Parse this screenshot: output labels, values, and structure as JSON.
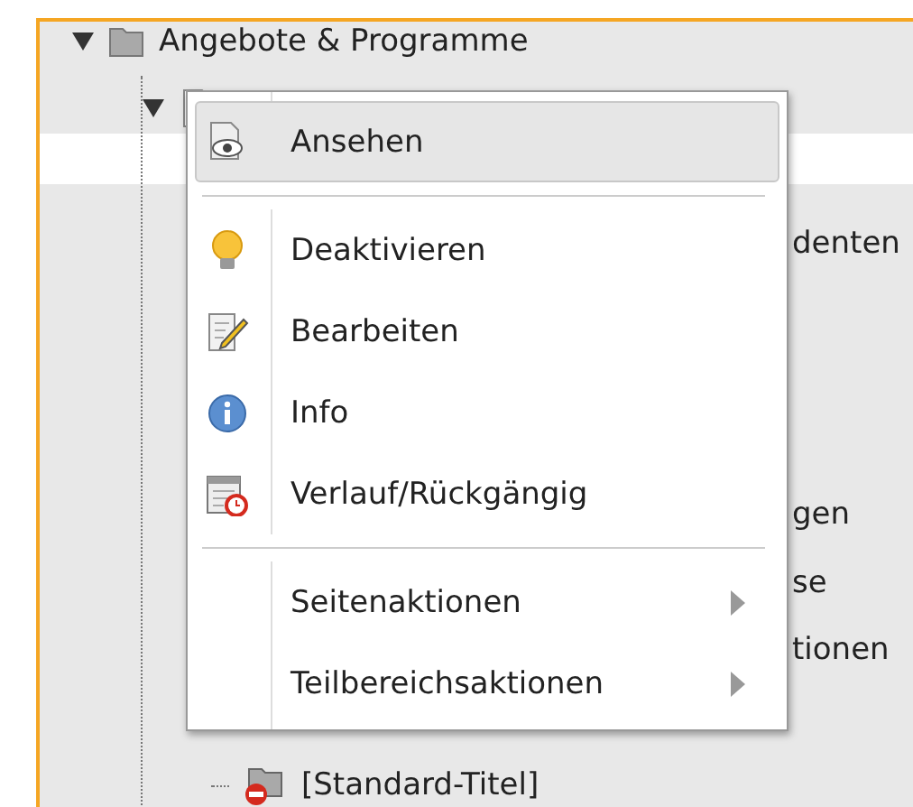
{
  "tree": [
    {
      "kind": "folder",
      "label": "Angebote & Programme",
      "expanded": true,
      "children": [
        {
          "kind": "page",
          "expanded": true,
          "children": [
            {
              "kind": "fragment",
              "label": "denten"
            },
            {
              "kind": "fragment",
              "label": "gen"
            },
            {
              "kind": "fragment",
              "label": "se"
            },
            {
              "kind": "fragment",
              "label": "tionen"
            },
            {
              "kind": "folder-hidden",
              "label": "[Standard-Titel]"
            }
          ]
        }
      ]
    }
  ],
  "context_menu": {
    "groups": [
      [
        {
          "label": "Ansehen",
          "kind": "view",
          "selected": true,
          "submenu": false
        }
      ],
      [
        {
          "label": "Deaktivieren",
          "kind": "bulb",
          "selected": false,
          "submenu": false
        },
        {
          "label": "Bearbeiten",
          "kind": "edit",
          "selected": false,
          "submenu": false
        },
        {
          "label": "Info",
          "kind": "info",
          "selected": false,
          "submenu": false
        },
        {
          "label": "Verlauf/Rückgängig",
          "kind": "history",
          "selected": false,
          "submenu": false
        }
      ],
      [
        {
          "label": "Seitenaktionen",
          "kind": "submenu",
          "selected": false,
          "submenu": true
        },
        {
          "label": "Teilbereichsaktionen",
          "kind": "submenu",
          "selected": false,
          "submenu": true
        }
      ]
    ]
  }
}
